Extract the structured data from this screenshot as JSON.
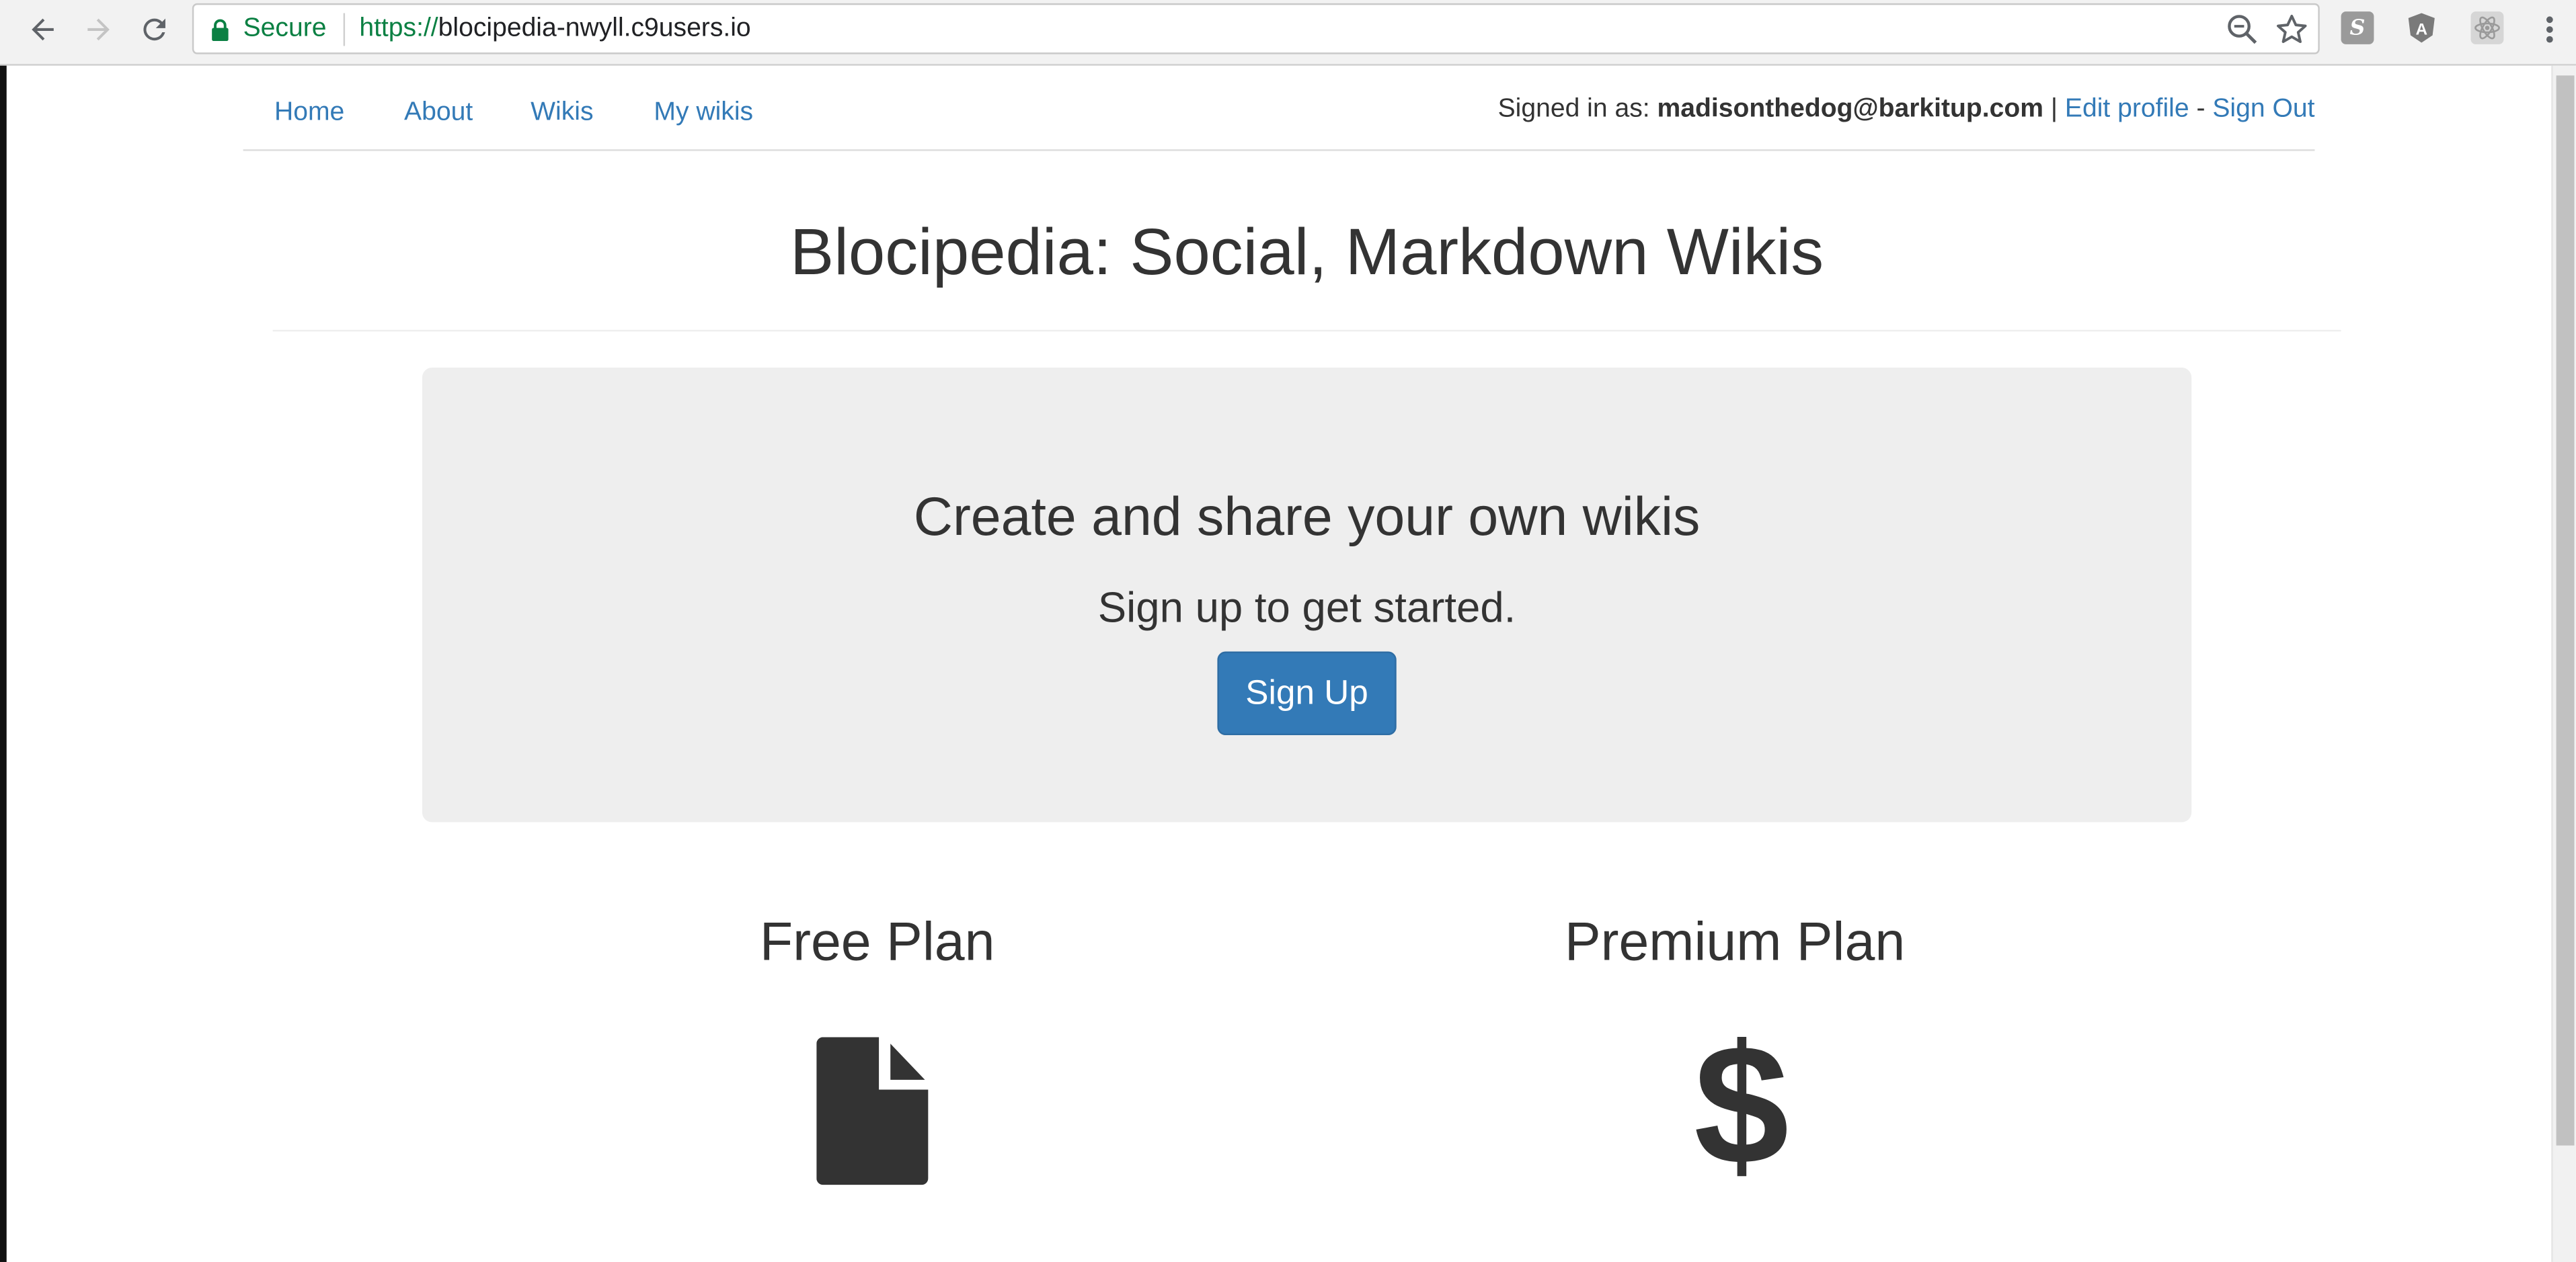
{
  "browser": {
    "secure_label": "Secure",
    "url_scheme": "https://",
    "url_host": "blocipedia-nwyll.c9users.io",
    "extensions": [
      "S",
      "A",
      "react"
    ]
  },
  "nav": {
    "links": [
      "Home",
      "About",
      "Wikis",
      "My wikis"
    ],
    "signed_in_prefix": "Signed in as: ",
    "user_email": "madisonthedog@barkitup.com",
    "separator_pipe": " | ",
    "edit_profile": "Edit profile",
    "separator_dash": " - ",
    "sign_out": "Sign Out"
  },
  "page": {
    "title": "Blocipedia: Social, Markdown Wikis"
  },
  "jumbotron": {
    "heading": "Create and share your own wikis",
    "subheading": "Sign up to get started.",
    "button": "Sign Up"
  },
  "plans": {
    "free": {
      "title": "Free Plan",
      "icon": "file-icon"
    },
    "premium": {
      "title": "Premium Plan",
      "icon": "dollar-icon",
      "symbol": "$"
    }
  },
  "colors": {
    "link": "#337ab7",
    "button_primary": "#337ab7",
    "jumbotron_bg": "#eeeeee",
    "secure_green": "#0b8043"
  }
}
